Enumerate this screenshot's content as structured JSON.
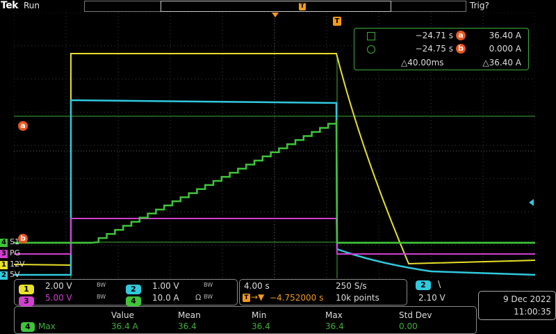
{
  "header": {
    "brand": "Tek",
    "run_state": "Run",
    "trigger_status": "Trig?",
    "trigger_marker": "T"
  },
  "colors": {
    "ch1": "#e8e12a",
    "ch2": "#30c9dd",
    "ch3": "#d13fd1",
    "ch4": "#3fc43a",
    "cursor": "#3fae3a",
    "badge": "#e8561f"
  },
  "channel_labels": [
    {
      "num": "4",
      "name": "S1",
      "color": "#3fc43a"
    },
    {
      "num": "3",
      "name": "PG",
      "color": "#d13fd1"
    },
    {
      "num": "1",
      "name": "12V",
      "color": "#e8e12a"
    },
    {
      "num": "2",
      "name": "5V",
      "color": "#30c9dd"
    }
  ],
  "cursor_markers": {
    "a": "a",
    "b": "b"
  },
  "cursor_readout": {
    "row1": {
      "time": "−24.71 s",
      "cursor": "a",
      "value": "36.40 A"
    },
    "row2": {
      "time": "−24.75 s",
      "cursor": "b",
      "value": "0.000 A"
    },
    "delta_time": "△40.00ms",
    "delta_value": "△36.40 A"
  },
  "vertical_settings": [
    {
      "num": "1",
      "scale": "2.00 V",
      "bw": "BW"
    },
    {
      "num": "2",
      "scale": "1.00 V",
      "bw": "BW"
    },
    {
      "num": "3",
      "scale": "5.00 V",
      "bw": "BW"
    },
    {
      "num": "4",
      "scale": "10.0 A",
      "bw": "BW",
      "extra": "Ω"
    }
  ],
  "horizontal": {
    "time_div": "4.00 s",
    "sample_rate": "250 S/s",
    "position": "−4.752000 s",
    "record": "10k points"
  },
  "trigger": {
    "source": "2",
    "slope": "\\",
    "level": "2.10 V"
  },
  "datetime": {
    "date": "9 Dec  2022",
    "time": "11:00:35"
  },
  "measurement": {
    "headers": [
      "Value",
      "Mean",
      "Min",
      "Max",
      "Std Dev"
    ],
    "row": {
      "channel": "4",
      "name": "Max",
      "values": [
        "36.4 A",
        "36.4",
        "36.4",
        "36.4",
        "0.00"
      ]
    }
  }
}
